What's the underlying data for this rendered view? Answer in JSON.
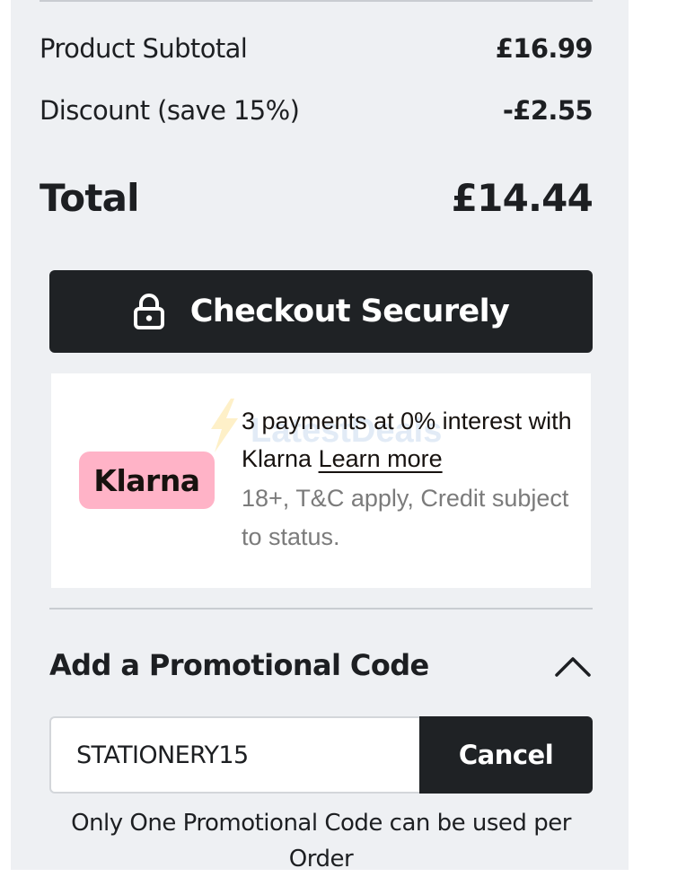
{
  "summary": {
    "subtotal_label": "Product Subtotal",
    "subtotal_value": "£16.99",
    "discount_label": "Discount (save 15%)",
    "discount_value": "-£2.55",
    "total_label": "Total",
    "total_value": "£14.44"
  },
  "checkout": {
    "icon": "lock-icon",
    "label": "Checkout Securely"
  },
  "klarna": {
    "logo_text": "Klarna",
    "logo_color": "#ffb3c7",
    "headline": "3 payments at 0% interest with Klarna",
    "learn_more": "Learn more",
    "terms": "18+, T&C apply, Credit subject to status."
  },
  "watermark": {
    "text": "LatestDeals",
    "icon": "lightning-bolt-icon"
  },
  "promo": {
    "title": "Add a Promotional Code",
    "toggle_icon": "chevron-up-icon",
    "code_value": "STATIONERY15",
    "cancel_label": "Cancel",
    "note": "Only One Promotional Code can be used per Order"
  },
  "colors": {
    "panel_bg": "#eef0f3",
    "button_bg": "#1f2225",
    "text": "#1d1f22"
  }
}
